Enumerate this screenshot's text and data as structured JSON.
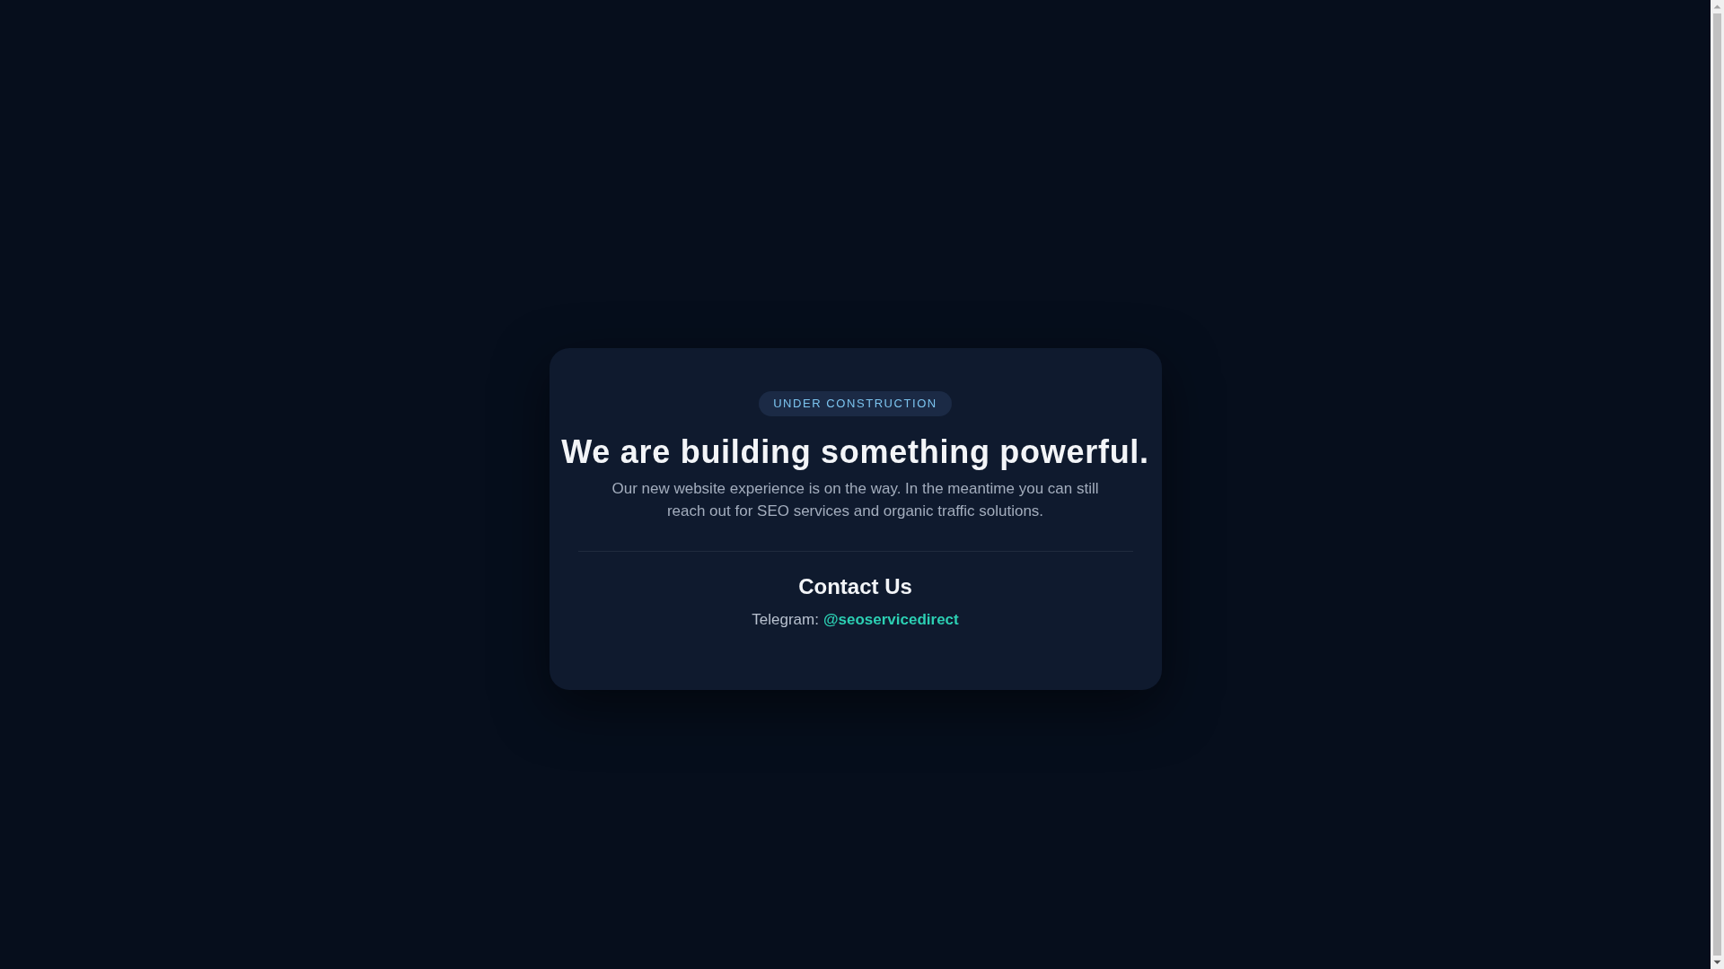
{
  "badge": "UNDER CONSTRUCTION",
  "heading": "We are building something powerful.",
  "description": "Our new website experience is on the way. In the meantime you can still reach out for SEO services and organic traffic solutions.",
  "contact": {
    "title": "Contact Us",
    "label": "Telegram:",
    "link": "@seoservicedirect"
  }
}
